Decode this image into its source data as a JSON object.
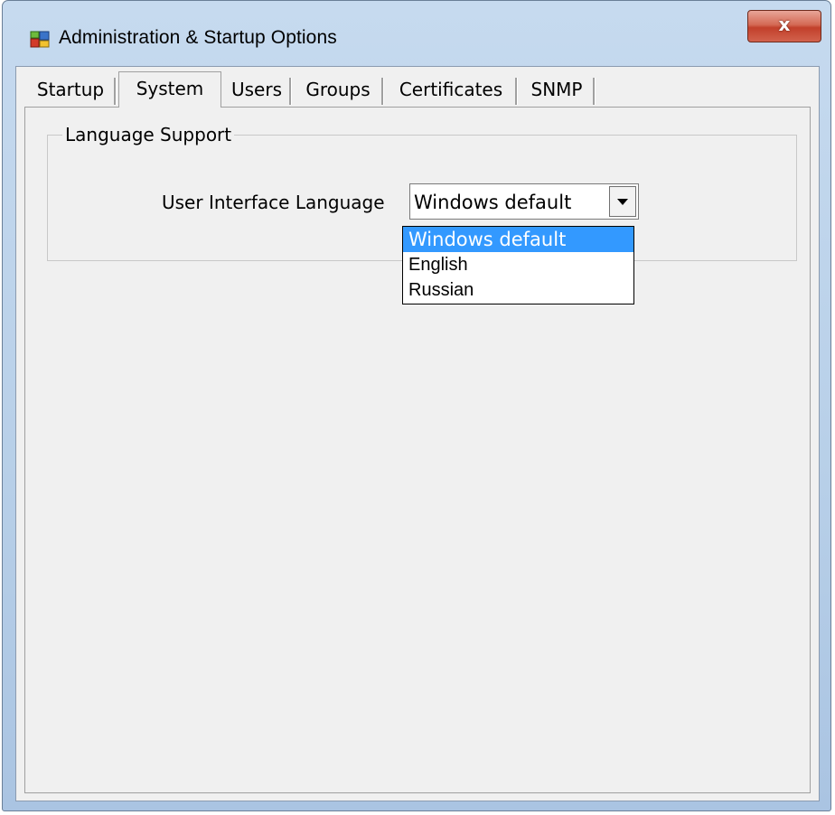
{
  "window": {
    "title": "Administration & Startup Options",
    "close_glyph": "x",
    "icon": "application-icon"
  },
  "tabs": [
    {
      "label": "Startup",
      "selected": false
    },
    {
      "label": "System",
      "selected": true
    },
    {
      "label": "Users",
      "selected": false
    },
    {
      "label": "Groups",
      "selected": false
    },
    {
      "label": "Certificates",
      "selected": false
    },
    {
      "label": "SNMP",
      "selected": false
    }
  ],
  "language_support": {
    "group_title": "Language Support",
    "field_label": "User Interface Language",
    "selected_value": "Windows default",
    "options": [
      "Windows default",
      "English",
      "Russian"
    ],
    "highlighted_option": "Windows default"
  },
  "colors": {
    "selection": "#3399ff",
    "close_button": "#c7432e",
    "frame": "#b9d1ea"
  }
}
